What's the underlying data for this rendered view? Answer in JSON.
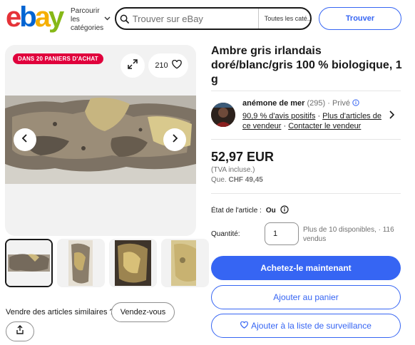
{
  "header": {
    "logo_letters": [
      "e",
      "b",
      "a",
      "y"
    ],
    "browse_label": "Parcourir les catégories",
    "search_placeholder": "Trouver sur eBay",
    "category_select": "Toutes les caté...",
    "search_button": "Trouver"
  },
  "gallery": {
    "badge": "DANS 20 PANIERS D'ACHAT",
    "watch_count": "210",
    "thumbnail_count": 4
  },
  "sell_similar": {
    "text": "Vendre des articles similaires ?",
    "button": "Vendez-vous"
  },
  "item": {
    "title": "Ambre gris irlandais doré/blanc/gris 100 % biologique, 1 g",
    "price": "52,97 EUR",
    "tva": "(TVA incluse.)",
    "approx_prefix": "Que.",
    "approx_value": "CHF 49,45",
    "condition_label": "État de l'article :",
    "condition_value": "Ou",
    "quantity_label": "Quantité:",
    "quantity_value": "1",
    "availability": "Plus de 10 disponibles, · 116 vendus"
  },
  "seller": {
    "name": "anémone de mer",
    "rating_count": "(295)",
    "type": "· Privé",
    "positive_feedback": "90,9 % d'avis positifs",
    "more_items": "Plus d'articles de ce vendeur",
    "contact": "Contacter le vendeur"
  },
  "actions": {
    "buy_now": "Achetez-le maintenant",
    "add_to_cart": "Ajouter au panier",
    "add_to_watchlist": "Ajouter à la liste de surveillance"
  },
  "colors": {
    "accent": "#3665f3",
    "badge": "#e0003c"
  }
}
